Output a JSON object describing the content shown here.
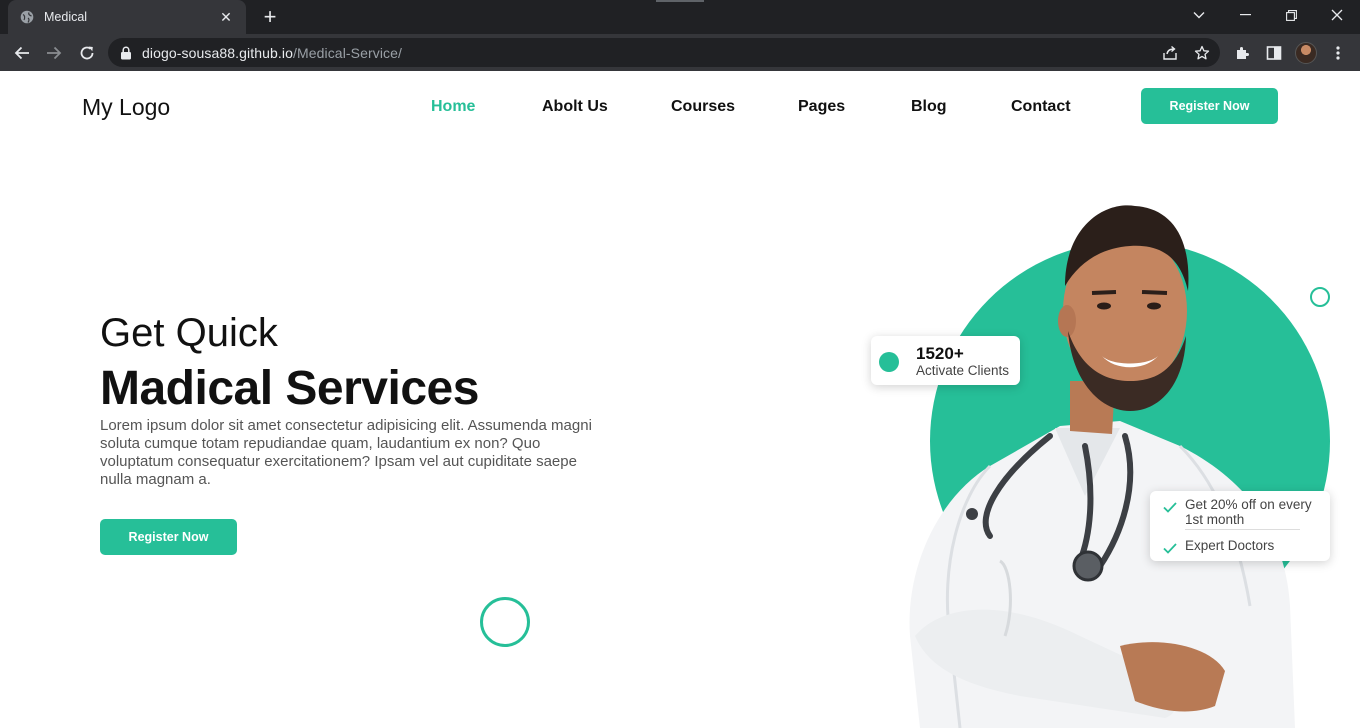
{
  "browser": {
    "tab_title": "Medical",
    "url_host": "diogo-sousa88.github.io",
    "url_path": "/Medical-Service/"
  },
  "header": {
    "logo": "My Logo",
    "nav": [
      {
        "label": "Home",
        "active": true
      },
      {
        "label": "Abolt Us",
        "active": false
      },
      {
        "label": "Courses",
        "active": false
      },
      {
        "label": "Pages",
        "active": false
      },
      {
        "label": "Blog",
        "active": false
      },
      {
        "label": "Contact",
        "active": false
      }
    ],
    "register_label": "Register Now"
  },
  "hero": {
    "subtitle": "Get Quick",
    "title": "Madical Services",
    "text": "Lorem ipsum dolor sit amet consectetur adipisicing elit. Assumenda magni soluta cumque totam repudiandae quam, laudantium ex non? Quo voluptatum consequatur exercitationem? Ipsam vel aut cupiditate saepe nulla magnam a.",
    "register_label": "Register Now"
  },
  "clients_card": {
    "count": "1520+",
    "label": "Activate Clients"
  },
  "features_card": {
    "items": [
      "Get 20% off on every 1st month",
      "Expert Doctors"
    ]
  },
  "colors": {
    "accent": "#26bf98",
    "chrome_dark": "#202124",
    "chrome_tab": "#35363a"
  }
}
